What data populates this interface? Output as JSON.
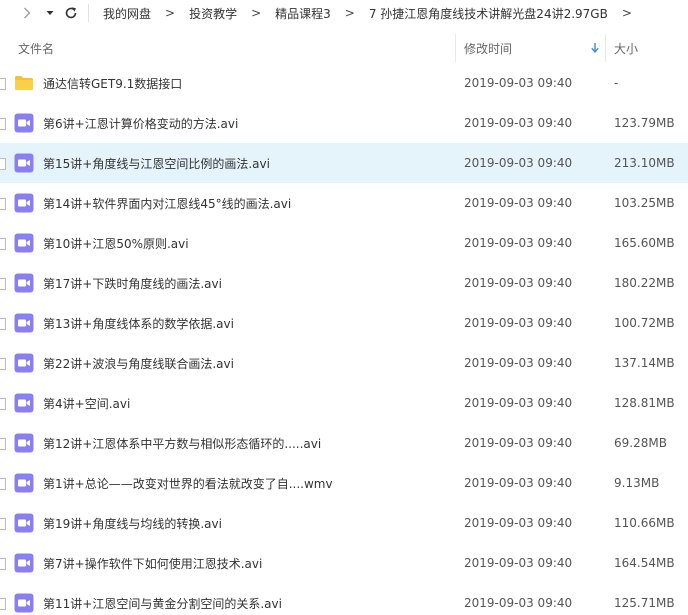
{
  "colors": {
    "accent": "#3b8fd6",
    "selected_row_bg": "#e5f3fb",
    "folder_icon": "#f7c02f",
    "video_icon": "#8a7ff0"
  },
  "toolbar": {
    "forward_icon": "chevron-right-icon",
    "dropdown_icon": "caret-down-icon",
    "refresh_icon": "refresh-icon",
    "breadcrumb": [
      {
        "label": "我的网盘"
      },
      {
        "label": "投资教学"
      },
      {
        "label": "精品课程3"
      },
      {
        "label": "7 孙捷江恩角度线技术讲解光盘24讲2.97GB"
      }
    ],
    "separator": ">"
  },
  "header": {
    "name_label": "文件名",
    "date_label": "修改时间",
    "size_label": "大小",
    "sort_icon": "sort-down-icon"
  },
  "files": [
    {
      "name": "通达信转GET9.1数据接口",
      "date": "2019-09-03 09:40",
      "size": "-",
      "type": "folder",
      "selected": false
    },
    {
      "name": "第6讲+江恩计算价格变动的方法.avi",
      "date": "2019-09-03 09:40",
      "size": "123.79MB",
      "type": "video",
      "selected": false
    },
    {
      "name": "第15讲+角度线与江恩空间比例的画法.avi",
      "date": "2019-09-03 09:40",
      "size": "213.10MB",
      "type": "video",
      "selected": true
    },
    {
      "name": "第14讲+软件界面内对江恩线45°线的画法.avi",
      "date": "2019-09-03 09:40",
      "size": "103.25MB",
      "type": "video",
      "selected": false
    },
    {
      "name": "第10讲+江恩50%原则.avi",
      "date": "2019-09-03 09:40",
      "size": "165.60MB",
      "type": "video",
      "selected": false
    },
    {
      "name": "第17讲+下跌时角度线的画法.avi",
      "date": "2019-09-03 09:40",
      "size": "180.22MB",
      "type": "video",
      "selected": false
    },
    {
      "name": "第13讲+角度线体系的数学依据.avi",
      "date": "2019-09-03 09:40",
      "size": "100.72MB",
      "type": "video",
      "selected": false
    },
    {
      "name": "第22讲+波浪与角度线联合画法.avi",
      "date": "2019-09-03 09:40",
      "size": "137.14MB",
      "type": "video",
      "selected": false
    },
    {
      "name": "第4讲+空间.avi",
      "date": "2019-09-03 09:40",
      "size": "128.81MB",
      "type": "video",
      "selected": false
    },
    {
      "name": "第12讲+江恩体系中平方数与相似形态循环的.....avi",
      "date": "2019-09-03 09:40",
      "size": "69.28MB",
      "type": "video",
      "selected": false
    },
    {
      "name": "第1讲+总论——改变对世界的看法就改变了自....wmv",
      "date": "2019-09-03 09:40",
      "size": "9.13MB",
      "type": "video",
      "selected": false
    },
    {
      "name": "第19讲+角度线与均线的转换.avi",
      "date": "2019-09-03 09:40",
      "size": "110.66MB",
      "type": "video",
      "selected": false
    },
    {
      "name": "第7讲+操作软件下如何使用江恩技术.avi",
      "date": "2019-09-03 09:40",
      "size": "164.54MB",
      "type": "video",
      "selected": false
    },
    {
      "name": "第11讲+江恩空间与黄金分割空间的关系.avi",
      "date": "2019-09-03 09:40",
      "size": "125.71MB",
      "type": "video",
      "selected": false
    }
  ]
}
